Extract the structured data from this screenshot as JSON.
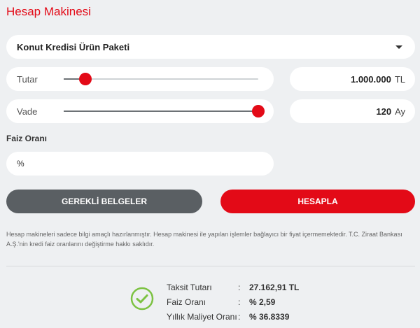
{
  "page": {
    "title": "Hesap Makinesi"
  },
  "product_select": {
    "selected": "Konut Kredisi Ürün Paketi"
  },
  "amount": {
    "label": "Tutar",
    "value": "1.000.000",
    "unit": "TL",
    "slider_fraction": 0.11
  },
  "term": {
    "label": "Vade",
    "value": "120",
    "unit": "Ay",
    "slider_fraction": 1.0
  },
  "interest": {
    "label": "Faiz Oranı",
    "input_value": "%"
  },
  "buttons": {
    "documents": "GEREKLİ BELGELER",
    "calculate": "HESAPLA"
  },
  "disclaimer": "Hesap makineleri sadece bilgi amaçlı hazırlanmıştır. Hesap makinesi ile yapılan işlemler bağlayıcı bir fiyat içermemektedir. T.C. Ziraat Bankası A.Ş.'nin kredi faiz oranlarını değiştirme hakkı saklıdır.",
  "results": {
    "separator": ":",
    "rows": [
      {
        "label": "Taksit Tutarı",
        "value": "27.162,91 TL"
      },
      {
        "label": "Faiz Oranı",
        "value": "% 2,59"
      },
      {
        "label": "Yıllık Maliyet Oranı",
        "value": "% 36.8339"
      }
    ]
  },
  "colors": {
    "accent": "#e30a17",
    "secondary_button": "#5a5f63",
    "success": "#7cc242",
    "background": "#eef0f2"
  }
}
